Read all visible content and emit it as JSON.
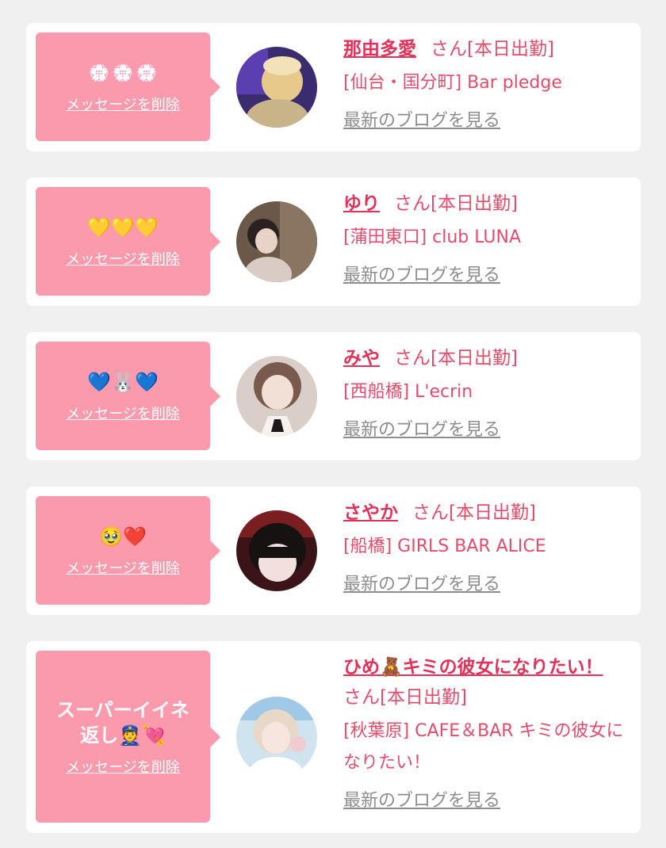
{
  "cards": [
    {
      "message": "💮💮💮",
      "delete_label": "メッセージを削除",
      "name": "那由多愛",
      "status": "さん[本日出勤]",
      "shop": "[仙台・国分町] Bar pledge",
      "blog_label": "最新のブログを見る"
    },
    {
      "message": "💛💛💛",
      "delete_label": "メッセージを削除",
      "name": "ゆり",
      "status": "さん[本日出勤]",
      "shop": "[蒲田東口] club LUNA",
      "blog_label": "最新のブログを見る"
    },
    {
      "message": "💙🐰💙",
      "delete_label": "メッセージを削除",
      "name": "みや",
      "status": "さん[本日出勤]",
      "shop": "[西船橋] L'ecrin",
      "blog_label": "最新のブログを見る"
    },
    {
      "message": "🥹❤️",
      "delete_label": "メッセージを削除",
      "name": "さやか",
      "status": "さん[本日出勤]",
      "shop": "[船橋] GIRLS BAR ALICE",
      "blog_label": "最新のブログを見る"
    },
    {
      "message": "スーパーイイネ返し👮💘",
      "delete_label": "メッセージを削除",
      "name": "ひめ🧸キミの彼女になりたい！",
      "status": "さん[本日出勤]",
      "shop": "[秋葉原] CAFE＆BAR キミの彼女になりたい！",
      "blog_label": "最新のブログを見る"
    }
  ]
}
